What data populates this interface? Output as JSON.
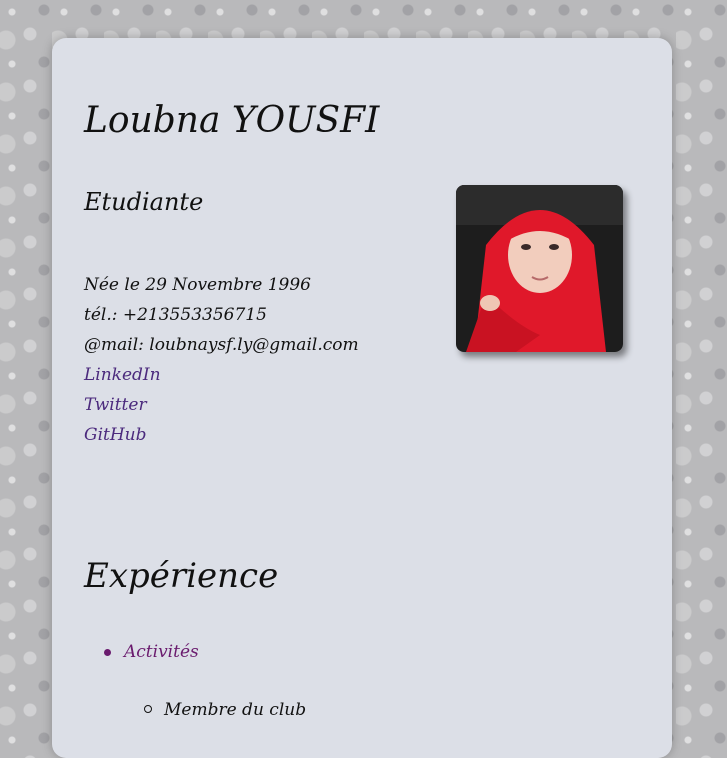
{
  "profile": {
    "name": "Loubna YOUSFI",
    "title": "Etudiante",
    "birth": "Née le 29 Novembre 1996",
    "phone": "tél.: +213553356715",
    "email": "@mail: loubnaysf.ly@gmail.com",
    "links": [
      "LinkedIn",
      "Twitter",
      "GitHub"
    ]
  },
  "experience": {
    "heading": "Expérience",
    "items": [
      {
        "label": "Activités",
        "sub": [
          "Membre du club"
        ]
      }
    ]
  },
  "colors": {
    "card": "#dcdfe7",
    "link": "#4b2a7d",
    "bullet_item": "#6a1b6e"
  }
}
